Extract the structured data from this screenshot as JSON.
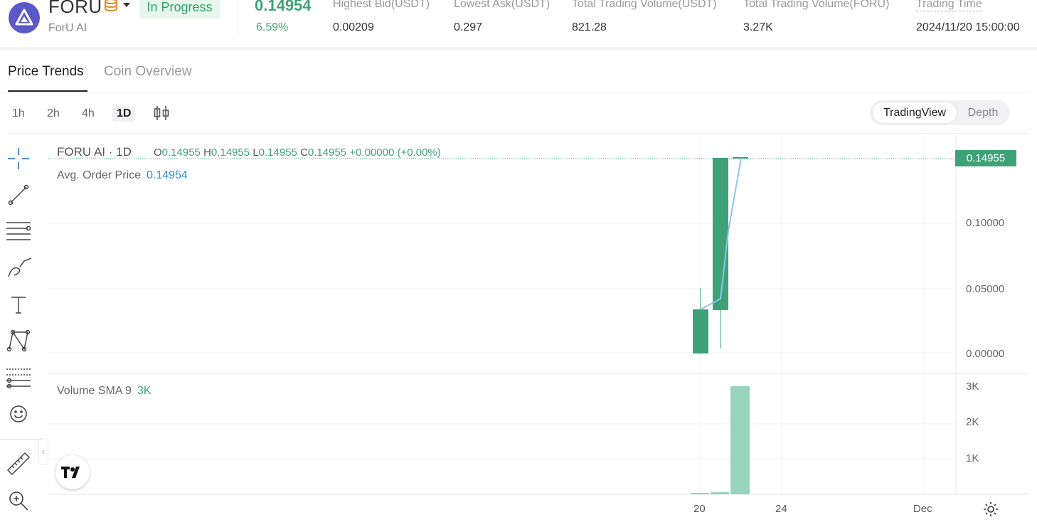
{
  "header": {
    "ticker": "FORU",
    "name": "ForU AI",
    "status": "In Progress",
    "last_price": "0.14954",
    "change_pct": "6.59%",
    "stats": [
      {
        "label": "Highest Bid(USDT)",
        "value": "0.00209"
      },
      {
        "label": "Lowest Ask(USDT)",
        "value": "0.297"
      },
      {
        "label": "Total Trading Volume(USDT)",
        "value": "821.28"
      },
      {
        "label": "Total Trading Volume(FORU)",
        "value": "3.27K"
      },
      {
        "label": "Trading Time",
        "value": "2024/11/20 15:00:00"
      }
    ]
  },
  "tabs": {
    "price_trends": "Price Trends",
    "coin_overview": "Coin Overview"
  },
  "intervals": [
    "1h",
    "2h",
    "4h",
    "1D"
  ],
  "view_toggle": {
    "tradingview": "TradingView",
    "depth": "Depth"
  },
  "chart": {
    "title": "FORU AI · 1D",
    "ohlc": {
      "o_label": "O",
      "o": "0.14955",
      "h_label": "H",
      "h": "0.14955",
      "l_label": "L",
      "l": "0.14955",
      "c_label": "C",
      "c": "0.14955",
      "change": "+0.00000 (+0.00%)"
    },
    "avg_label": "Avg. Order Price",
    "avg_value": "0.14954",
    "current_price_tag": "0.14955",
    "price_axis": [
      "0.10000",
      "0.05000",
      "0.00000"
    ],
    "volume_label": "Volume SMA 9",
    "volume_value": "3K",
    "volume_axis": [
      "3K",
      "2K",
      "1K"
    ],
    "date_axis": [
      "20",
      "24",
      "Dec"
    ],
    "colors": {
      "up": "#3ea278",
      "volume": "#99d4be",
      "avg_line": "#8ec4ef"
    }
  }
}
